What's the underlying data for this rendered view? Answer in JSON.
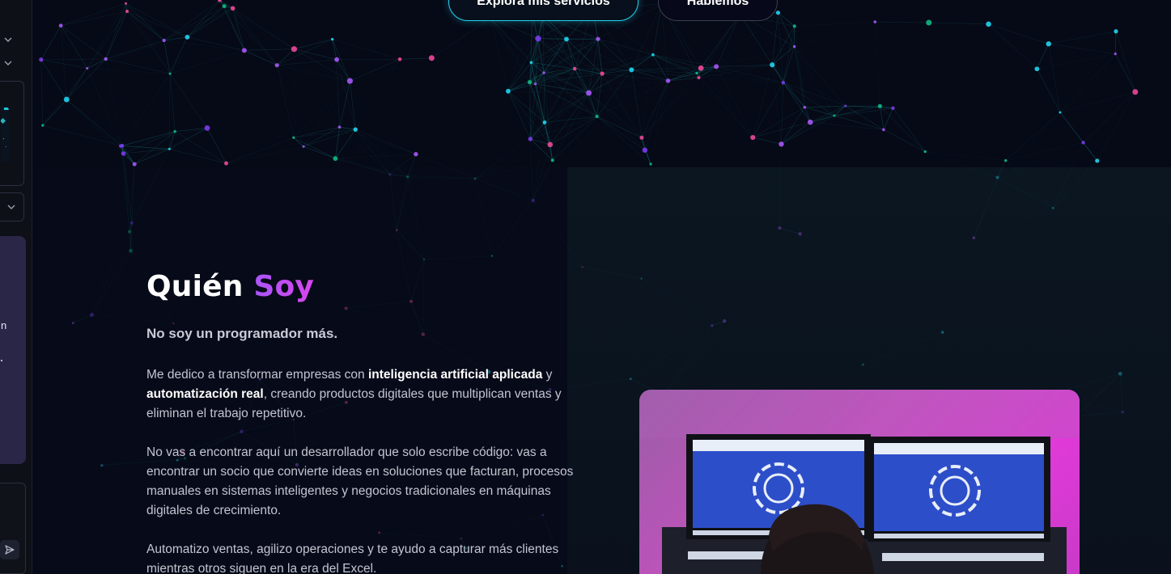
{
  "sidebar": {
    "icons": [
      "chevron-down-icon",
      "chevron-down-icon",
      "chevron-down-icon",
      "send-icon"
    ],
    "partial_text": "n"
  },
  "hero": {
    "primary_button": "Explora mis servicios",
    "secondary_button": "Hablemos"
  },
  "about": {
    "title_main": "Quién ",
    "title_accent": "Soy",
    "subtitle": "No soy un programador más.",
    "para1": {
      "t1": "Me dedico a transformar empresas con ",
      "b1": "inteligencia artificial aplicada",
      "t2": " y ",
      "b2": "automatización real",
      "t3": ", creando productos digitales que multiplican ventas y eliminan el trabajo repetitivo."
    },
    "para2": "No vas a encontrar aquí un desarrollador que solo escribe código: vas a encontrar un socio que convierte ideas en soluciones que facturan, procesos manuales en sistemas inteligentes y negocios tradicionales en máquinas digitales de crecimiento.",
    "para3": "Automatizo ventas, agilizo operaciones y te ayudo a capturar más clientes mientras otros siguen en la era del Excel.",
    "photo_icon": "portrait-photo"
  },
  "colors": {
    "background": "#070a18",
    "accent_cyan": "#22d3ee",
    "accent_purple": "#a855f7",
    "accent_magenta": "#d946ef",
    "node_green": "#10b981",
    "node_pink": "#ec4899"
  }
}
